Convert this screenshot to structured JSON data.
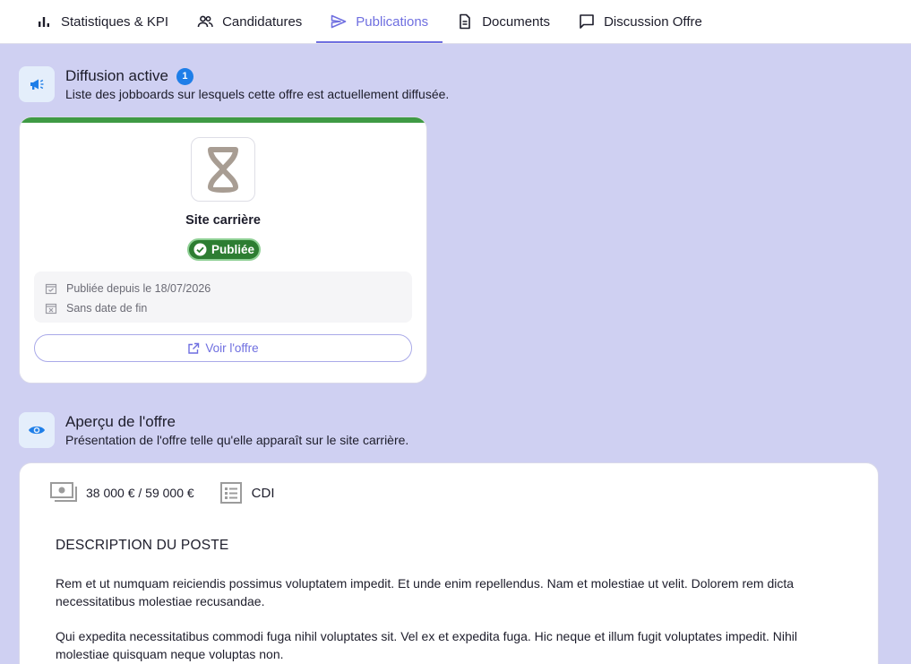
{
  "tabs": [
    {
      "label": "Statistiques & KPI",
      "icon": "bar-chart-icon",
      "active": false
    },
    {
      "label": "Candidatures",
      "icon": "people-icon",
      "active": false
    },
    {
      "label": "Publications",
      "icon": "send-icon",
      "active": true
    },
    {
      "label": "Documents",
      "icon": "document-icon",
      "active": false
    },
    {
      "label": "Discussion Offre",
      "icon": "chat-icon",
      "active": false
    }
  ],
  "diffusion": {
    "title": "Diffusion active",
    "count": "1",
    "subtitle": "Liste des jobboards sur lesquels cette offre est actuellement diffusée.",
    "icon": "megaphone-icon"
  },
  "board": {
    "name": "Site carrière",
    "status": "Publiée",
    "published_since": "Publiée depuis le 18/07/2026",
    "end_date": "Sans date de fin",
    "view_label": "Voir l'offre",
    "accent_color": "#3f9a44",
    "status_color": "#2d7d32"
  },
  "preview": {
    "title": "Aperçu de l'offre",
    "subtitle": "Présentation de l'offre telle qu'elle apparaît sur le site carrière.",
    "icon": "eye-icon",
    "salary": "38 000 € / 59 000 €",
    "contract": "CDI",
    "desc_title": "DESCRIPTION DU POSTE",
    "paragraphs": [
      "Rem et ut numquam reiciendis possimus voluptatem impedit. Et unde enim repellendus. Nam et molestiae ut velit. Dolorem rem dicta necessitatibus molestiae recusandae.",
      "Qui expedita necessitatibus commodi fuga nihil voluptates sit. Vel ex et expedita fuga. Hic neque et illum fugit voluptates impedit. Nihil molestiae quisquam neque voluptas non."
    ]
  },
  "colors": {
    "accent": "#6f6fe0",
    "background": "#cfd0f2",
    "badge": "#1e7ee8"
  }
}
